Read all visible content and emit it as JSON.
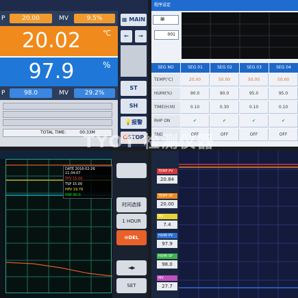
{
  "panel1": {
    "date": "2016-02-26",
    "sv_label": "P",
    "sv_value": "20.00",
    "mv_label": "MV",
    "mv_value": "9.5%",
    "pv_value": "20.02",
    "pv_unit": "℃",
    "rh_value": "97.9",
    "rh_unit": "%",
    "rh_sv_label": "P",
    "rh_sv_value": "98.0",
    "rh_mv_label": "MV",
    "rh_mv_value": "29.2%",
    "total_time_label": "TOTAL TIME:",
    "total_time_value": "00:33M",
    "buttons": {
      "main": "MAIN",
      "back": "←",
      "next": "→",
      "st": "ST",
      "sh": "SH",
      "alarm": "报警",
      "stop": "STOP"
    }
  },
  "panel2": {
    "title": "程序设定",
    "segment_label": "SEG NO",
    "segments": [
      "SEG 01",
      "SEG 02",
      "SEG 03",
      "SEG 04"
    ],
    "rows": [
      {
        "label": "TEMP(℃)",
        "values": [
          "20.00",
          "50.00",
          "50.00",
          "50.00"
        ]
      },
      {
        "label": "HUMI(%)",
        "values": [
          "90.0",
          "90.0",
          "95.0",
          "95.0"
        ]
      },
      {
        "label": "TIME(H.M)",
        "values": [
          "0.10",
          "0.30",
          "0.10",
          "0.10"
        ]
      },
      {
        "label": "RHP ON",
        "values": [
          "✔",
          "✔",
          "✔",
          "✔"
        ]
      },
      {
        "label": "END",
        "values": [
          "OFF",
          "OFF",
          "OFF",
          "OFF"
        ]
      }
    ],
    "input_value": "001",
    "mode_label": "编"
  },
  "panel3": {
    "legend": [
      {
        "label": "DATE",
        "value": "2016-02-26 11:34:07",
        "color": "#ffffff"
      },
      {
        "label": "TPV",
        "value": "15.00",
        "color": "#ff4040"
      },
      {
        "label": "TSP",
        "value": "15.00",
        "color": "#ffffff"
      },
      {
        "label": "HPV",
        "value": "19.79",
        "color": "#ffe94a"
      },
      {
        "label": "HSP",
        "value": "90.0",
        "color": "#00ff00"
      }
    ],
    "buttons": {
      "b1": "",
      "b2": "时间选择",
      "b3": "1 HOUR",
      "b4": "DEL",
      "b5": "◄▶",
      "b6": "SET"
    }
  },
  "panel4": {
    "items": [
      {
        "tag": "TEMP PV",
        "value": "20.84",
        "color": "#d63a3a"
      },
      {
        "tag": "TEMP SP",
        "value": "20.00",
        "color": "#f08a1c"
      },
      {
        "tag": "MV",
        "value": "7.4",
        "color": "#e8d23a"
      },
      {
        "tag": "HUMI PV",
        "value": "97.9",
        "color": "#2f70d8"
      },
      {
        "tag": "HUMI SP",
        "value": "98.0",
        "color": "#3cb44b"
      },
      {
        "tag": "MV",
        "value": "27.7",
        "color": "#c050c0"
      }
    ]
  },
  "watermark": "TYOT 检测仪器",
  "colors": {
    "orange": "#f08a1c",
    "blue": "#1f77d8",
    "dark": "#2c3e5c",
    "chart_bg": "#06120f",
    "chart_grid": "#2ca08c"
  }
}
